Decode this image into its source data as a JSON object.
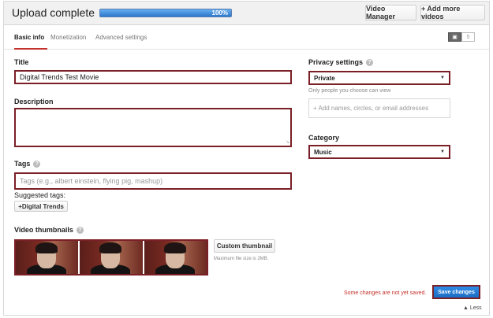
{
  "header": {
    "title": "Upload complete",
    "progress_text": "100%",
    "progress_value": 1.0,
    "video_manager_label": "Video Manager",
    "add_more_label": "+ Add more videos"
  },
  "tabs": [
    {
      "label": "Basic info"
    },
    {
      "label": "Monetization"
    },
    {
      "label": "Advanced settings"
    }
  ],
  "privacy_icons": {
    "lock": "lock-icon",
    "count": "5"
  },
  "form": {
    "title_label": "Title",
    "title_value": "Digital Trends Test Movie",
    "description_label": "Description",
    "description_value": "",
    "tags_label": "Tags",
    "tags_placeholder": "Tags (e.g., albert einstein, flying pig, mashup)",
    "suggested_tags_label": "Suggested tags:",
    "suggested_tags": [
      "+Digital Trends"
    ],
    "thumbnails_label": "Video thumbnails",
    "custom_thumbnail_label": "Custom thumbnail",
    "max_file_size": "Maximum file size is 2MB."
  },
  "privacy": {
    "label": "Privacy settings",
    "selected": "Private",
    "note": "Only people you choose can view",
    "share_placeholder": "+ Add names, circles, or email addresses"
  },
  "category": {
    "label": "Category",
    "selected": "Music"
  },
  "footer": {
    "unsaved_text": "Some changes are not yet saved.",
    "save_label": "Save changes",
    "less_label": "▲ Less"
  },
  "colors": {
    "accent_blue": "#2a77cc",
    "highlight_border": "#7a1f26",
    "warning_red": "#c4302b"
  }
}
